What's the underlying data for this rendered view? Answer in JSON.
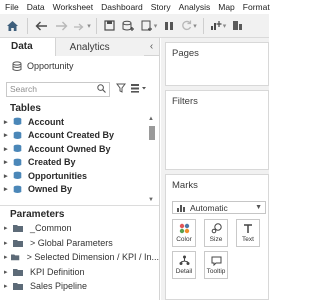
{
  "menu": [
    "File",
    "Data",
    "Worksheet",
    "Dashboard",
    "Story",
    "Analysis",
    "Map",
    "Format"
  ],
  "toolbar": {
    "icons": [
      "tableau-home-icon",
      "back-arrow-icon",
      "forward-arrow-icon",
      "redo-icon",
      "save-icon",
      "new-datasource-icon",
      "new-worksheet-icon",
      "pause-icon",
      "refresh-icon",
      "show-me-chart-icon",
      "sort-icon"
    ]
  },
  "left_pane": {
    "tabs": {
      "data": "Data",
      "analytics": "Analytics",
      "collapse": "‹"
    },
    "datasource": "Opportunity",
    "search_placeholder": "Search",
    "tables_title": "Tables",
    "tables": [
      "Account",
      "Account Created By",
      "Account Owned By",
      "Created By",
      "Opportunities",
      "Owned By"
    ],
    "parameters_title": "Parameters",
    "parameters": [
      "_Common",
      "> Global Parameters",
      "> Selected Dimension / KPI / In...",
      "KPI Definition",
      "Sales Pipeline"
    ]
  },
  "shelves": {
    "pages_title": "Pages",
    "filters_title": "Filters",
    "marks_title": "Marks",
    "mark_type": "Automatic",
    "buttons": {
      "color": "Color",
      "size": "Size",
      "text": "Text",
      "detail": "Detail",
      "tooltip": "Tooltip"
    }
  },
  "colors": {
    "table_icon": "#4b87b8",
    "folder_icon": "#5d6b78",
    "toolbar_bg": "#f1f1f1",
    "shelf_bg": "#f1f1f1"
  }
}
